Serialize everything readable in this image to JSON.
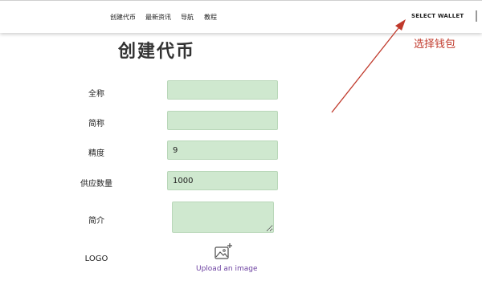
{
  "nav": {
    "items": [
      {
        "label": "创建代币"
      },
      {
        "label": "最新资讯"
      },
      {
        "label": "导航"
      },
      {
        "label": "教程"
      }
    ],
    "select_wallet": "SELECT WALLET"
  },
  "page": {
    "title": "创建代币"
  },
  "annotation": {
    "text": "选择钱包",
    "color": "#c0392b"
  },
  "form": {
    "fields": [
      {
        "label": "全称",
        "value": ""
      },
      {
        "label": "简称",
        "value": ""
      },
      {
        "label": "精度",
        "value": "9"
      },
      {
        "label": "供应数量",
        "value": "1000"
      }
    ],
    "description_label": "简介",
    "logo_label": "LOGO",
    "upload_text": "Upload an image",
    "upload_icon": "image-add-icon"
  },
  "colors": {
    "field_bg": "#cfe8cf",
    "upload_link": "#6b3fa0"
  }
}
